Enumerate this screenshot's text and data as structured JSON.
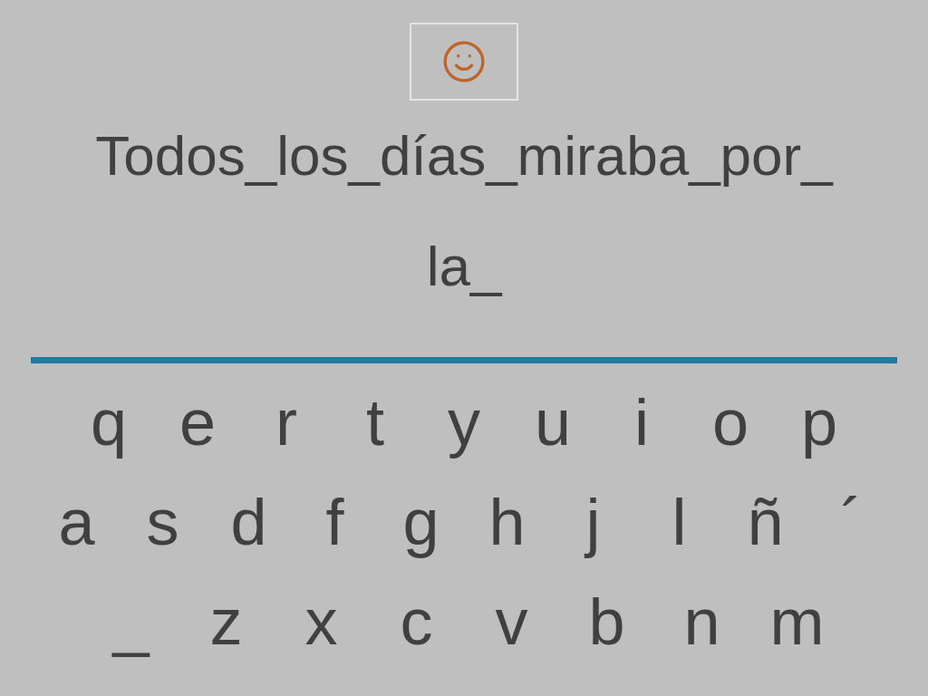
{
  "sentence_lines": [
    "Todos_los_días_miraba_por_",
    "la_"
  ],
  "keyboard": {
    "rows": [
      [
        "q",
        "e",
        "r",
        "t",
        "y",
        "u",
        "i",
        "o",
        "p"
      ],
      [
        "a",
        "s",
        "d",
        "f",
        "g",
        "h",
        "j",
        "l",
        "ñ",
        "´"
      ],
      [
        "_",
        "z",
        "x",
        "c",
        "v",
        "b",
        "n",
        "m"
      ]
    ]
  }
}
